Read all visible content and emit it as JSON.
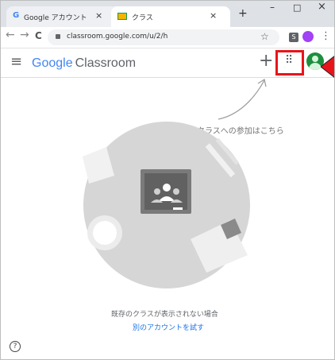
{
  "browser": {
    "tabs": [
      {
        "favicon": "G",
        "title": "Google アカウント",
        "close": "×"
      },
      {
        "title": "クラス",
        "close": "×"
      }
    ],
    "new_tab": "+",
    "window_controls": {
      "minimize": "–",
      "maximize": "□",
      "close": "×"
    },
    "nav": {
      "back": "←",
      "forward": "→",
      "reload": "C"
    },
    "url": "classroom.google.com/u/2/h",
    "extension_badge": "S",
    "menu": "⋮",
    "star": "☆"
  },
  "app": {
    "menu_icon": "≡",
    "brand_google": "Google",
    "brand_product": "Classroom",
    "add": "+",
    "apps_grid": "⠿",
    "highlight_color": "#e8141b",
    "avatar_color": "#1e8e3e"
  },
  "hint": {
    "join_class": "クラスへの参加はこちら"
  },
  "empty_state": {
    "message": "既存のクラスが表示されない場合",
    "switch_account": "別のアカウントを試す"
  },
  "help": "?"
}
